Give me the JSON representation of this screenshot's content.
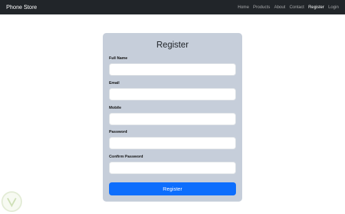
{
  "navbar": {
    "brand": "Phone Store",
    "links": [
      {
        "label": "Home",
        "active": false
      },
      {
        "label": "Products",
        "active": false
      },
      {
        "label": "About",
        "active": false
      },
      {
        "label": "Contact",
        "active": false
      },
      {
        "label": "Register",
        "active": true
      },
      {
        "label": "Login",
        "active": false
      }
    ]
  },
  "form": {
    "title": "Register",
    "fields": [
      {
        "label": "Full Name",
        "value": ""
      },
      {
        "label": "Email",
        "value": ""
      },
      {
        "label": "Mobile",
        "value": ""
      },
      {
        "label": "Password",
        "value": ""
      },
      {
        "label": "Confirm Password",
        "value": ""
      }
    ],
    "submit_label": "Register"
  },
  "colors": {
    "navbar_bg": "#212529",
    "card_bg": "#c6ceda",
    "primary": "#0d6efd"
  }
}
